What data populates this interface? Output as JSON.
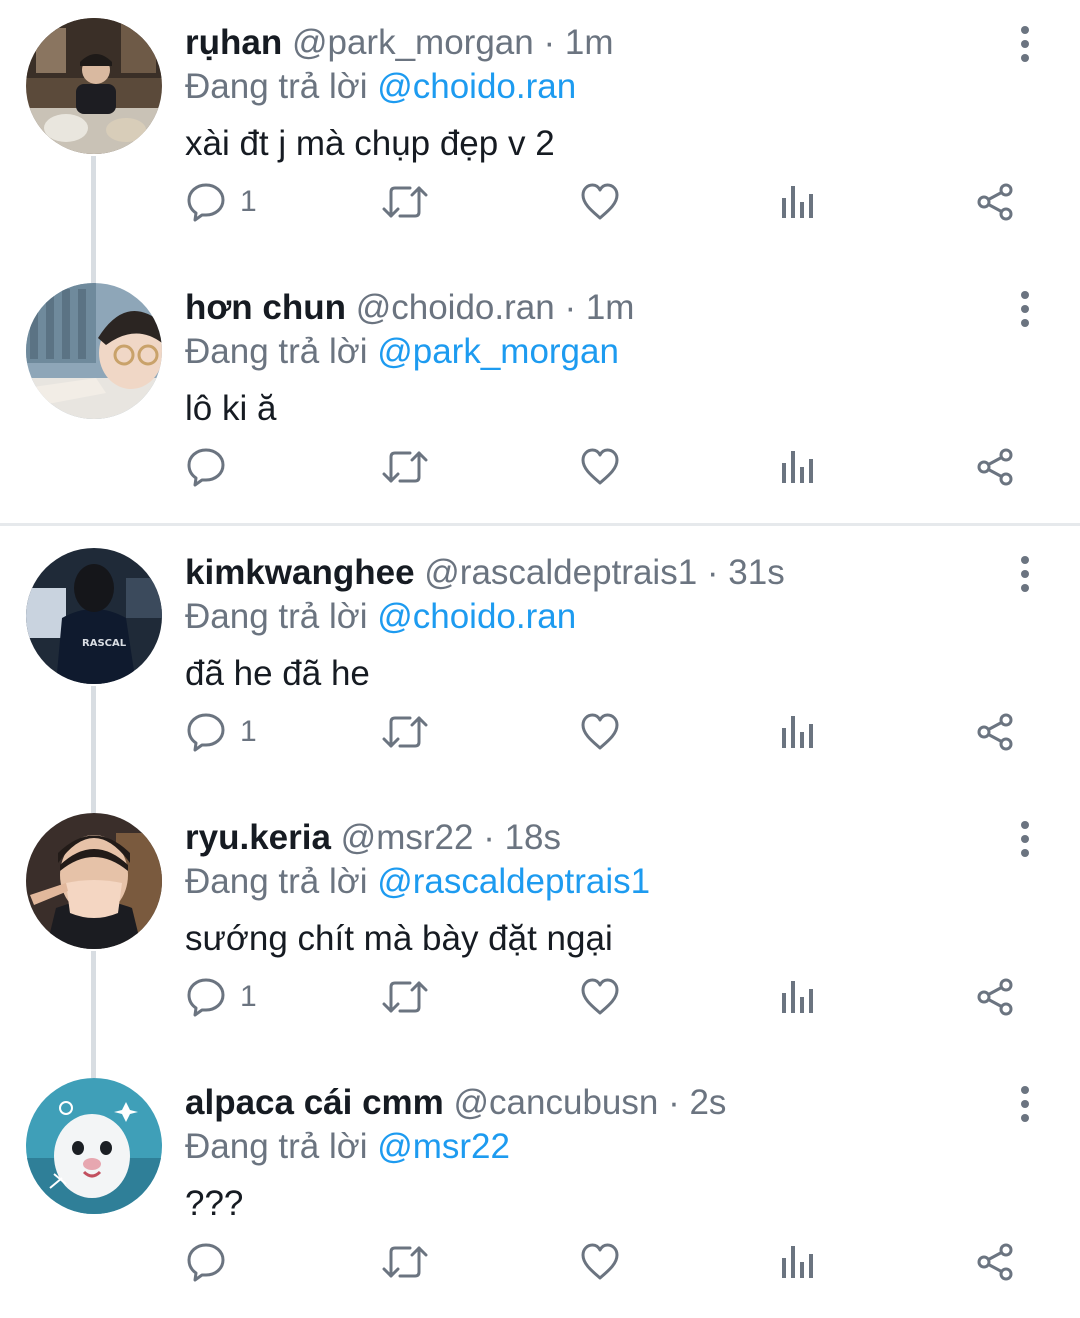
{
  "reply_prefix": "Đang trả lời",
  "colors": {
    "name": "#161b22",
    "muted": "#6b7480",
    "link": "#1d9bf0",
    "thread_line": "#d8dde2",
    "divider": "#e6e9ec"
  },
  "tweets": [
    {
      "name": "rụhan",
      "handle": "@park_morgan",
      "time": "1m",
      "reply_to": "@choido.ran",
      "text": "xài đt j mà chụp đẹp v 2",
      "reply_count": "1",
      "avatar": "avatar-dinner-photo"
    },
    {
      "name": "hơn chun",
      "handle": "@choido.ran",
      "time": "1m",
      "reply_to": "@park_morgan",
      "text": "lô ki ă",
      "reply_count": "",
      "avatar": "avatar-selfie-glasses"
    },
    {
      "name": "kimkwanghee",
      "handle": "@rascaldeptrais1",
      "time": "31s",
      "reply_to": "@choido.ran",
      "text": "đã he đã he",
      "reply_count": "1",
      "avatar": "avatar-rascal-jacket"
    },
    {
      "name": "ryu.keria",
      "handle": "@msr22",
      "time": "18s",
      "reply_to": "@rascaldeptrais1",
      "text": "sướng chít mà bày đặt ngại",
      "reply_count": "1",
      "avatar": "avatar-mask-selfie"
    },
    {
      "name": "alpaca cái cmm",
      "handle": "@cancubusn",
      "time": "2s",
      "reply_to": "@msr22",
      "text": "???",
      "reply_count": "",
      "avatar": "avatar-white-ferret"
    }
  ]
}
